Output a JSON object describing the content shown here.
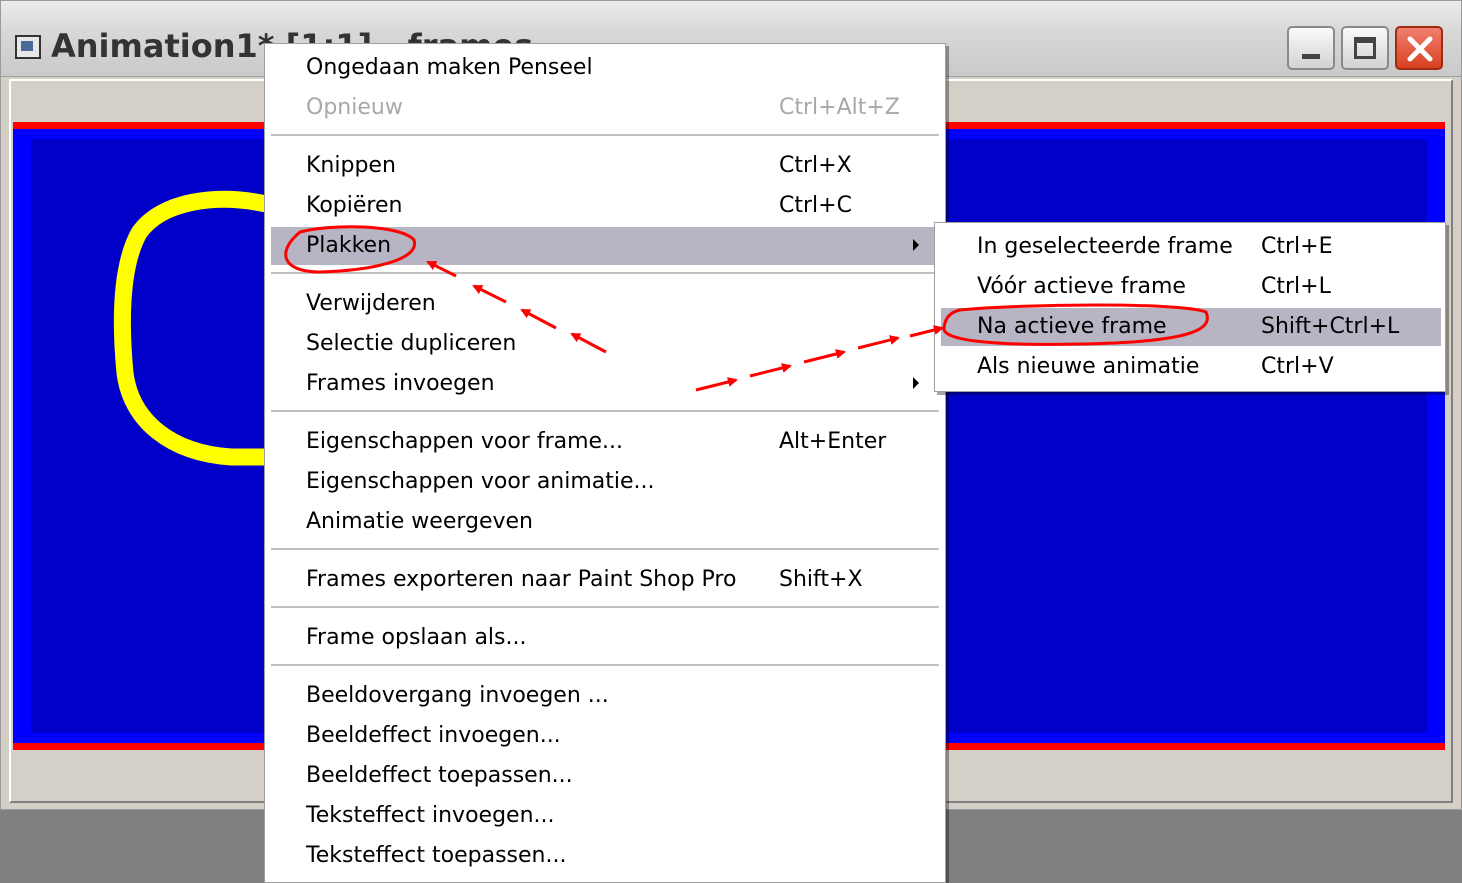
{
  "window": {
    "title": "Animation1* [1:1] - frames",
    "minimize_label": "minimize",
    "maximize_label": "maximize",
    "close_label": "close"
  },
  "menu": {
    "items": [
      {
        "label": "Ongedaan maken Penseel",
        "shortcut": ""
      },
      {
        "label": "Opnieuw",
        "shortcut": "Ctrl+Alt+Z",
        "disabled": true
      },
      {
        "label": "Knippen",
        "shortcut": "Ctrl+X"
      },
      {
        "label": "Kopiëren",
        "shortcut": "Ctrl+C"
      },
      {
        "label": "Plakken",
        "shortcut": "",
        "submenu": true,
        "highlighted": true
      },
      {
        "label": "Verwijderen",
        "shortcut": ""
      },
      {
        "label": "Selectie dupliceren",
        "shortcut": ""
      },
      {
        "label": "Frames invoegen",
        "shortcut": "",
        "submenu": true
      },
      {
        "label": "Eigenschappen voor frame...",
        "shortcut": "Alt+Enter"
      },
      {
        "label": "Eigenschappen voor animatie...",
        "shortcut": ""
      },
      {
        "label": "Animatie weergeven",
        "shortcut": ""
      },
      {
        "label": "Frames exporteren naar Paint Shop Pro",
        "shortcut": "Shift+X"
      },
      {
        "label": "Frame opslaan als...",
        "shortcut": ""
      },
      {
        "label": "Beeldovergang invoegen ...",
        "shortcut": ""
      },
      {
        "label": "Beeldeffect invoegen...",
        "shortcut": ""
      },
      {
        "label": "Beeldeffect toepassen...",
        "shortcut": ""
      },
      {
        "label": "Teksteffect invoegen...",
        "shortcut": ""
      },
      {
        "label": "Teksteffect toepassen...",
        "shortcut": ""
      }
    ]
  },
  "submenu": {
    "items": [
      {
        "label": "In geselecteerde frame",
        "shortcut": "Ctrl+E"
      },
      {
        "label": "Vóór actieve frame",
        "shortcut": "Ctrl+L"
      },
      {
        "label": "Na actieve frame",
        "shortcut": "Shift+Ctrl+L",
        "highlighted": true
      },
      {
        "label": "Als nieuwe animatie",
        "shortcut": "Ctrl+V"
      }
    ]
  },
  "colors": {
    "frame_blue": "#0000ff",
    "frame_border_red": "#ff0000",
    "shape_yellow": "#ffff00",
    "annotation_red": "#ff0000",
    "menu_highlight": "#b7b5c4"
  }
}
